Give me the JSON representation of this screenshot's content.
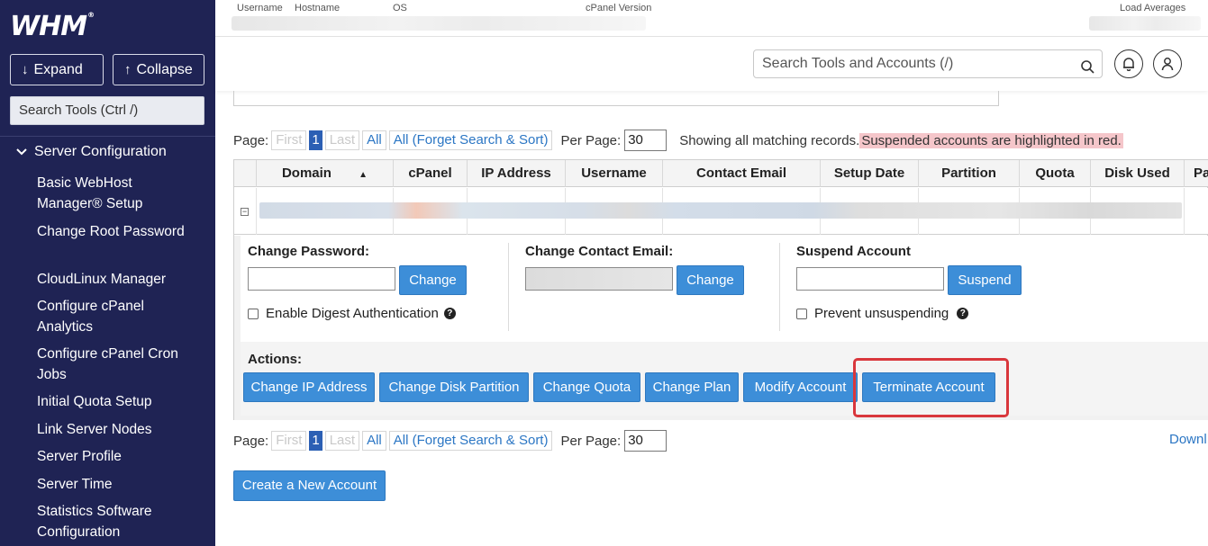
{
  "sidebar": {
    "logo": "WHM",
    "logo_mark": "®",
    "expand_label": "Expand",
    "collapse_label": "Collapse",
    "search_placeholder": "Search Tools (Ctrl /)",
    "section": "Server Configuration",
    "items": [
      "Basic WebHost Manager® Setup",
      "Change Root Password",
      "CloudLinux Manager",
      "Configure cPanel Analytics",
      "Configure cPanel Cron Jobs",
      "Initial Quota Setup",
      "Link Server Nodes",
      "Server Profile",
      "Server Time",
      "Statistics Software Configuration"
    ]
  },
  "topbar": {
    "username": "Username",
    "hostname": "Hostname",
    "os": "OS",
    "cpanel_version": "cPanel Version",
    "load_averages": "Load Averages"
  },
  "header": {
    "search_placeholder": "Search Tools and Accounts (/)"
  },
  "pager": {
    "label": "Page:",
    "first": "First",
    "current": "1",
    "last": "Last",
    "all": "All",
    "forget": "All (Forget Search & Sort)",
    "per_page_label": "Per Page:",
    "per_page_value": "30",
    "showing": "Showing all matching records.",
    "suspended_note": "Suspended accounts are highlighted in red."
  },
  "table": {
    "columns": [
      "Domain",
      "cPanel",
      "IP Address",
      "Username",
      "Contact Email",
      "Setup Date",
      "Partition",
      "Quota",
      "Disk Used",
      "Pa"
    ],
    "sort_indicator": "▲",
    "collapse_glyph": "−"
  },
  "detail": {
    "change_password_label": "Change Password:",
    "change_button": "Change",
    "digest_label": "Enable Digest Authentication",
    "change_email_label": "Change Contact Email:",
    "change_email_button": "Change",
    "suspend_label": "Suspend Account",
    "suspend_button": "Suspend",
    "prevent_label": "Prevent unsuspending",
    "help_glyph": "?",
    "actions_label": "Actions:",
    "actions": [
      "Change IP Address",
      "Change Disk Partition",
      "Change Quota",
      "Change Plan",
      "Modify Account",
      "Terminate Account"
    ]
  },
  "bottom": {
    "download_link": "Downl",
    "create_button": "Create a New Account"
  },
  "colors": {
    "sidebar_bg": "#1f2354",
    "button_blue": "#3d8ed8",
    "highlight_red": "#d9373c",
    "suspended_bg": "#f5c6ca"
  }
}
